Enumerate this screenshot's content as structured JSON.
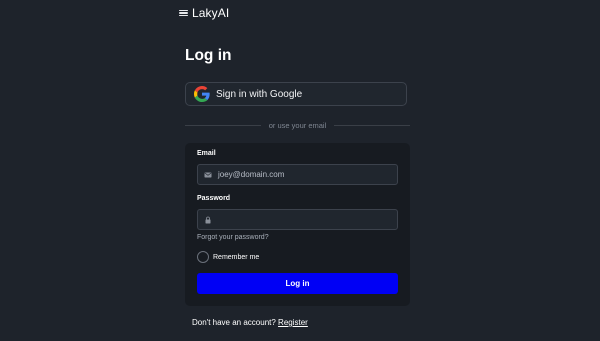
{
  "header": {
    "brand": "LakyAI"
  },
  "login": {
    "title": "Log in",
    "google_label": "Sign in with Google",
    "divider_text": "or use your email",
    "email_label": "Email",
    "email_value": "joey@domain.com",
    "password_label": "Password",
    "password_value": "",
    "forgot_label": "Forgot your password?",
    "remember_label": "Remember me",
    "remember_checked": false,
    "submit_label": "Log in"
  },
  "footer": {
    "prompt": "Don't have an account?",
    "register_label": "Register"
  },
  "icons": {
    "menu": "hamburger-menu-icon",
    "google": "google-g-icon",
    "email": "envelope-icon",
    "password": "lock-icon"
  },
  "colors": {
    "background": "#1e232b",
    "card": "#171b21",
    "input_border": "#3c424c",
    "primary_button": "#0000f5",
    "text": "#ffffff",
    "muted_text": "#7f8691"
  }
}
